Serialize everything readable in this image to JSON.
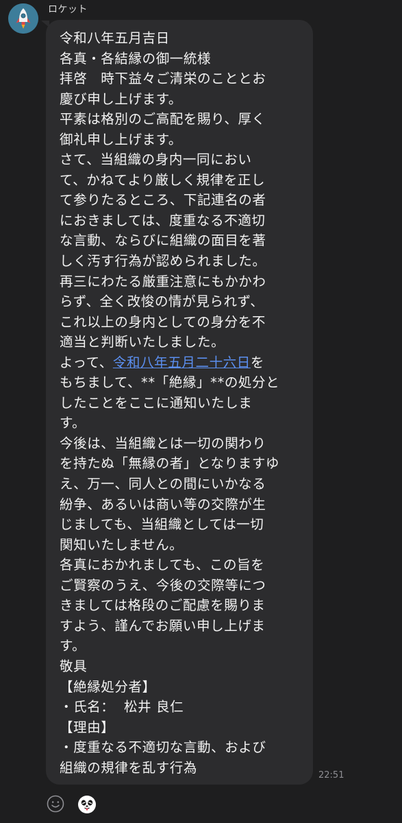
{
  "chat": {
    "sender": {
      "name": "ロケット",
      "avatar_icon": "rocket-icon"
    },
    "message": {
      "lines_before_link": [
        "令和八年五月吉日",
        "各真・各結縁の御一統様",
        "拝啓　時下益々ご清栄のこととお",
        "慶び申し上げます。",
        "平素は格別のご高配を賜り、厚く",
        "御礼申し上げます。",
        "さて、当組織の身内一同におい",
        "て、かねてより厳しく規律を正し",
        "て参りたるところ、下記連名の者",
        "におきましては、度重なる不適切",
        "な言動、ならびに組織の面目を著",
        "しく汚す行為が認められました。",
        "再三にわたる厳重注意にもかかわ",
        "らず、全く改悛の情が見られず、",
        "これ以上の身内としての身分を不",
        "適当と判断いたしました。"
      ],
      "link_prefix": "よって、",
      "link_text": "令和八年五月二十六日",
      "link_suffix": "を",
      "lines_after_link": [
        "もちまして、**「絶縁」**の処分と",
        "したことをここに通知いたしま",
        "す。",
        "今後は、当組織とは一切の関わり",
        "を持たぬ「無縁の者」となりますゆ",
        "え、万一、同人との間にいかなる",
        "紛争、あるいは商い等の交際が生",
        "じましても、当組織としては一切",
        "関知いたしません。",
        "各真におかれましても、この旨を",
        "ご賢察のうえ、今後の交際等につ",
        "きましては格段のご配慮を賜りま",
        "すよう、謹んでお願い申し上げま",
        "す。",
        "敬具",
        "【絶縁処分者】",
        "・氏名：  松井 良仁",
        "【理由】",
        "・度重なる不適切な言動、および",
        "組織の規律を乱す行為"
      ],
      "timestamp": "22:51"
    },
    "reactions": {
      "add_reaction_icon": "smiley-outline-icon",
      "sticker_icon": "panda-tongue-sticker-icon"
    },
    "colors": {
      "background": "#1e1e1f",
      "bubble": "#2c2c2e",
      "text": "#f2f2f2",
      "link": "#5b8ff0",
      "timestamp": "#8e8e93",
      "avatar_bg": "#3d7d9a"
    }
  }
}
